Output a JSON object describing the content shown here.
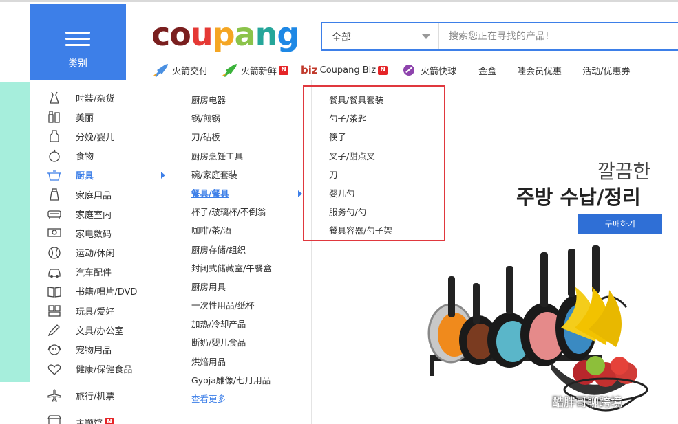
{
  "header": {
    "category_label": "类别",
    "logo": [
      {
        "ch": "c",
        "color": "#7a1f1f"
      },
      {
        "ch": "o",
        "color": "#7a1f1f"
      },
      {
        "ch": "u",
        "color": "#e53935"
      },
      {
        "ch": "p",
        "color": "#f5a623"
      },
      {
        "ch": "a",
        "color": "#8bc34a"
      },
      {
        "ch": "n",
        "color": "#26a69a"
      },
      {
        "ch": "g",
        "color": "#1e88e5"
      }
    ],
    "search": {
      "scope_value": "全部",
      "placeholder": "搜索您正在寻找的产品!"
    }
  },
  "subnav": {
    "rocket_delivery": "火箭交付",
    "rocket_fresh": "火箭新鲜",
    "biz_prefix": "biz",
    "biz_label": "Coupang Biz",
    "rocket_express": "火箭快球",
    "gold_box": "金盒",
    "wow_member": "哇会员优惠",
    "events": "活动/优惠券",
    "new_badge": "N"
  },
  "categories": [
    {
      "label": "时装/杂货",
      "icon": "dress-icon"
    },
    {
      "label": "美丽",
      "icon": "cosmetics-icon"
    },
    {
      "label": "分娩/婴儿",
      "icon": "baby-bottle-icon"
    },
    {
      "label": "食物",
      "icon": "apple-icon"
    },
    {
      "label": "厨具",
      "icon": "pot-icon"
    },
    {
      "label": "家庭用品",
      "icon": "detergent-icon"
    },
    {
      "label": "家庭室内",
      "icon": "sofa-icon"
    },
    {
      "label": "家电数码",
      "icon": "monitor-icon"
    },
    {
      "label": "运动/休闲",
      "icon": "ball-icon"
    },
    {
      "label": "汽车配件",
      "icon": "car-icon"
    },
    {
      "label": "书籍/唱片/DVD",
      "icon": "book-icon"
    },
    {
      "label": "玩具/爱好",
      "icon": "toy-icon"
    },
    {
      "label": "文具/办公室",
      "icon": "pencil-icon"
    },
    {
      "label": "宠物用品",
      "icon": "dog-icon"
    },
    {
      "label": "健康/保健食品",
      "icon": "heart-icon"
    }
  ],
  "travel": "旅行/机票",
  "theme_hall": "主题馆",
  "subcategories": [
    "厨房电器",
    "锅/煎锅",
    "刀/砧板",
    "厨房烹饪工具",
    "碗/家庭套装",
    "餐具/餐具",
    "杯子/玻璃杯/不倒翁",
    "咖啡/茶/酒",
    "厨房存储/组织",
    "封闭式储藏室/午餐盒",
    "厨房用具",
    "一次性用品/纸杯",
    "加热/冷却产品",
    "断奶/婴儿食品",
    "烘焙用品",
    "Gyoja雕像/七月用品"
  ],
  "see_more": "查看更多",
  "tertiary": [
    "餐具/餐具套装",
    "勺子/茶匙",
    "筷子",
    "叉子/甜点叉",
    "刀",
    "婴儿勺",
    "服务勺/勺",
    "餐具容器/勺子架"
  ],
  "banner": {
    "kr_small": "깔끔한",
    "kr_big": "주방 수납/정리",
    "buy_label": "구매하기"
  },
  "watermark": "酷胖哥聊跨境",
  "colors": {
    "accent": "#3d7fe8",
    "highlight": "#e0383e",
    "teal": "#a6eedc"
  }
}
